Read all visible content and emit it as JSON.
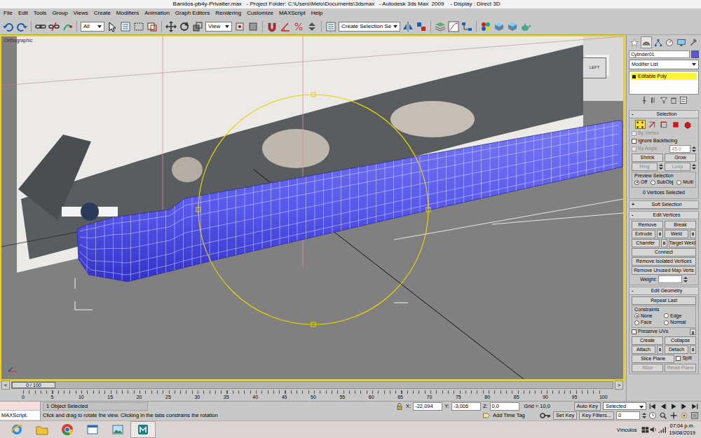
{
  "window": {
    "title": "Banidos-pb4y-Privatter.max   - Project Folder: C:\\Users\\Melo\\Documents\\3dsmax   - Autodesk 3ds Max  2009    - Display : Direct 3D"
  },
  "menu": [
    "File",
    "Edit",
    "Tools",
    "Group",
    "Views",
    "Create",
    "Modifiers",
    "Animation",
    "Graph Editors",
    "Rendering",
    "Customize",
    "MAXScript",
    "Help"
  ],
  "toolbar": {
    "selection_filter": "All",
    "reference_coordinate": "View",
    "named_selection": "Create Selection Se"
  },
  "viewport": {
    "label": "Orthographic",
    "viewcube": "LEFT",
    "active": true
  },
  "command_panel": {
    "tabs": [
      {
        "selected": false
      },
      {
        "selected": true
      },
      {
        "selected": false
      },
      {
        "selected": false
      },
      {
        "selected": false
      },
      {
        "selected": false
      }
    ],
    "object_name": "Cylinder01",
    "object_color": "#5656ee",
    "modifier_list": "Modifier List",
    "stack": [
      {
        "label": "Editable Poly",
        "selected": true
      }
    ],
    "selection": {
      "title": "Selection",
      "toggle": "-",
      "levels": [
        {
          "selected": true
        },
        {
          "selected": false
        },
        {
          "selected": false
        },
        {
          "selected": false
        },
        {
          "selected": false
        }
      ],
      "options": [
        {
          "label": "By Vertex",
          "checked": false,
          "disabled": true
        },
        {
          "label": "Ignore Backfacing",
          "checked": false,
          "disabled": false
        },
        {
          "label": "By Angle",
          "checked": false,
          "disabled": true
        }
      ],
      "angle": "45.0",
      "buttons": [
        {
          "label": "Shrink",
          "disabled": false
        },
        {
          "label": "Grow",
          "disabled": false
        },
        {
          "label": "Ring",
          "disabled": true
        },
        {
          "label": "Loop",
          "disabled": true
        }
      ],
      "preview_label": "Preview Selection",
      "preview": [
        {
          "label": "Off",
          "selected": true
        },
        {
          "label": "SubObj",
          "selected": false
        },
        {
          "label": "Multi",
          "selected": false
        }
      ],
      "status": "0 Vertices Selected"
    },
    "soft_selection": {
      "title": "Soft Selection",
      "toggle": "+"
    },
    "edit_vertices": {
      "title": "Edit Vertices",
      "toggle": "-",
      "rows": [
        [
          {
            "label": "Remove",
            "settings": false
          },
          {
            "label": "Break",
            "settings": false
          }
        ],
        [
          {
            "label": "Extrude",
            "settings": true
          },
          {
            "label": "Weld",
            "settings": true
          }
        ],
        [
          {
            "label": "Chamfer",
            "settings": true
          },
          {
            "label": "Target Weld",
            "settings": false
          }
        ],
        [
          {
            "label": "Connect",
            "settings": false
          }
        ],
        [
          {
            "label": "Remove Isolated Vertices",
            "settings": false
          }
        ],
        [
          {
            "label": "Remove Unused Map Verts",
            "settings": false
          }
        ]
      ],
      "weight_label": "Weight:",
      "weight": ""
    },
    "edit_geometry": {
      "title": "Edit Geometry",
      "toggle": "-",
      "repeat": "Repeat Last",
      "constraints_label": "Constraints",
      "constraints": [
        {
          "label": "None",
          "selected": true
        },
        {
          "label": "Edge",
          "selected": false
        },
        {
          "label": "Face",
          "selected": false
        },
        {
          "label": "Normal",
          "selected": false
        }
      ],
      "preserve_uvs": {
        "label": "Preserve UVs",
        "checked": false
      },
      "rows": [
        [
          {
            "label": "Create",
            "settings": false
          },
          {
            "label": "Collapse",
            "settings": false
          }
        ],
        [
          {
            "label": "Attach",
            "settings": true
          },
          {
            "label": "Detach",
            "settings": true
          }
        ]
      ],
      "slice_plane": "Slice Plane",
      "split": {
        "label": "Split",
        "checked": false
      },
      "slice_buttons": [
        {
          "label": "Slice",
          "disabled": true
        },
        {
          "label": "Reset Plane",
          "disabled": true
        }
      ]
    }
  },
  "time_slider": {
    "position": "0 / 100",
    "level": 0,
    "prev": "<",
    "next": ">"
  },
  "track_bar": {
    "ticks": [
      "0",
      "5",
      "10",
      "15",
      "20",
      "25",
      "30",
      "35",
      "40",
      "45",
      "50",
      "55",
      "60",
      "65",
      "70",
      "75",
      "80",
      "85",
      "90",
      "95",
      "100"
    ]
  },
  "status_bar": {
    "listener": "MAXScript.",
    "selection": "1 Object Selected",
    "prompt": "Click and drag to rotate the view.  Clicking in the tabs constrains the rotation",
    "coords": [
      {
        "axis": "X:",
        "value": "-22,094"
      },
      {
        "axis": "Y:",
        "value": "-3,006"
      },
      {
        "axis": "Z:",
        "value": "0,0"
      }
    ],
    "grid": "Grid = 10,0",
    "add_time_tag": "Add Time Tag",
    "auto_key": "Auto Key",
    "key_mode": "Selected",
    "set_key": "Set Key",
    "key_filters": "Key Filters...",
    "frame": "0"
  },
  "taskbar": {
    "apps": [
      {
        "selected": false
      },
      {
        "selected": false
      },
      {
        "selected": false
      },
      {
        "selected": false
      },
      {
        "selected": false
      },
      {
        "selected": true
      }
    ],
    "toolbar": "Vínculos",
    "time": "07:04 p.m.",
    "date": "19/08/2019"
  }
}
